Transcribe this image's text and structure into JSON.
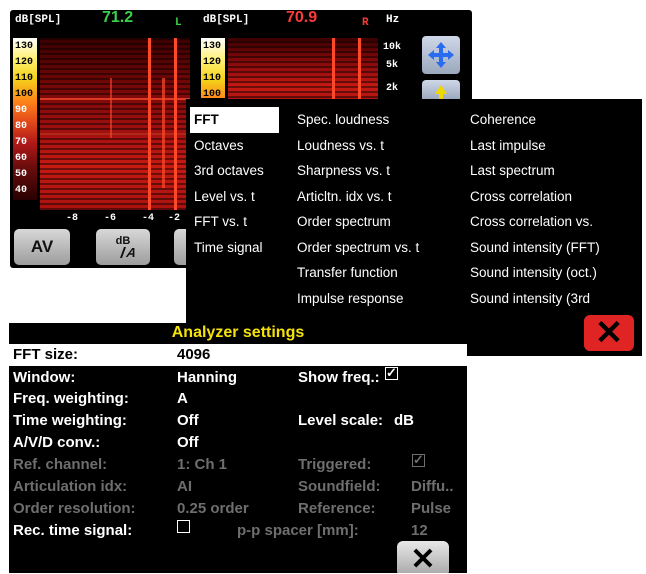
{
  "spectrogram": {
    "left": {
      "unit": "dB[SPL]",
      "level": "71.2",
      "channel": "L"
    },
    "right": {
      "unit": "dB[SPL]",
      "level": "70.9",
      "channel": "R"
    },
    "freq_unit": "Hz",
    "scale_ticks": [
      "130",
      "120",
      "110",
      "100",
      "90",
      "80",
      "70",
      "60",
      "50",
      "40"
    ],
    "scale_ticks_right": [
      "130",
      "120",
      "110",
      "100"
    ],
    "freq_labels": [
      "10k",
      "5k",
      "2k"
    ],
    "x_ticks": [
      "-8",
      "-6",
      "-4",
      "-2"
    ],
    "buttons": {
      "av": "AV",
      "db_a_top": "dB",
      "db_a_bottom": "A"
    },
    "colors": {
      "left_level": "#3bd14a",
      "right_level": "#ff3a3a",
      "channel_left": "#3bd14a",
      "channel_right": "#ff3a3a"
    }
  },
  "menu": {
    "col1": [
      "FFT",
      "Octaves",
      "3rd octaves",
      "Level vs. t",
      "FFT vs. t",
      "Time signal"
    ],
    "col2": [
      "Spec. loudness",
      "Loudness vs. t",
      "Sharpness vs. t",
      "Articltn. idx vs. t",
      "Order spectrum",
      "Order spectrum vs. t",
      "Transfer function",
      "Impulse response"
    ],
    "col3": [
      "Coherence",
      "Last impulse",
      "Last spectrum",
      "Cross correlation",
      "Cross correlation vs.",
      "Sound intensity (FFT)",
      "Sound intensity (oct.)",
      "Sound intensity (3rd"
    ],
    "selected": "FFT",
    "close_symbol": "✕"
  },
  "settings": {
    "title": "Analyzer settings",
    "fft_size_label": "FFT size:",
    "fft_size_value": "4096",
    "window_label": "Window:",
    "window_value": "Hanning",
    "show_freq_label": "Show freq.:",
    "show_freq_checked": true,
    "freq_weighting_label": "Freq. weighting:",
    "freq_weighting_value": "A",
    "time_weighting_label": "Time weighting:",
    "time_weighting_value": "Off",
    "level_scale_label": "Level scale:",
    "level_scale_value": "dB",
    "avd_label": "A/V/D conv.:",
    "avd_value": "Off",
    "ref_channel_label": "Ref. channel:",
    "ref_channel_value": "1: Ch 1",
    "triggered_label": "Triggered:",
    "triggered_checked": true,
    "articulation_label": "Articulation idx:",
    "articulation_value": "AI",
    "soundfield_label": "Soundfield:",
    "soundfield_value": "Diffu..",
    "order_res_label": "Order resolution:",
    "order_res_value": "0.25 order",
    "reference_label": "Reference:",
    "reference_value": "Pulse",
    "rec_time_label": "Rec. time signal:",
    "rec_time_checked": false,
    "spacer_label": "p-p spacer [mm]:",
    "spacer_value": "12",
    "close_symbol": "✕"
  }
}
